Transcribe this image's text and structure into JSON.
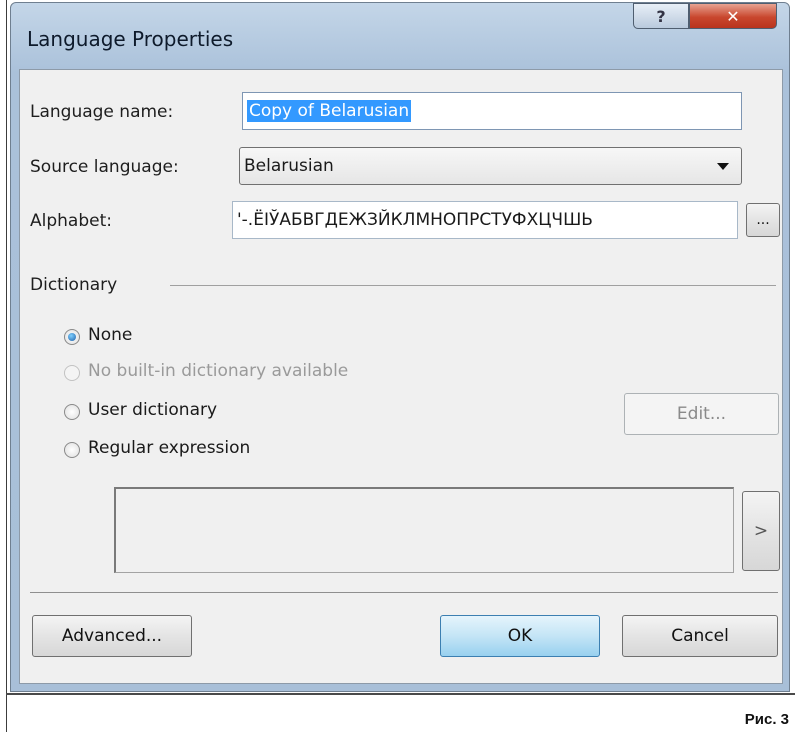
{
  "window": {
    "title": "Language Properties",
    "help_glyph": "?",
    "close_glyph": "✕"
  },
  "fields": {
    "language_name_label": "Language name:",
    "language_name_value": "Copy of Belarusian",
    "source_language_label": "Source language:",
    "source_language_value": "Belarusian",
    "alphabet_label": "Alphabet:",
    "alphabet_value": "'-.ЁІЎАБВГДЕЖЗЙКЛМНОПРСТУФХЦЧШЬ",
    "alphabet_button": "..."
  },
  "dictionary": {
    "heading": "Dictionary",
    "options": [
      {
        "label": "None",
        "selected": true,
        "enabled": true
      },
      {
        "label": "No built-in dictionary available",
        "selected": false,
        "enabled": false
      },
      {
        "label": "User dictionary",
        "selected": false,
        "enabled": true
      },
      {
        "label": "Regular expression",
        "selected": false,
        "enabled": true
      }
    ],
    "edit_button": "Edit...",
    "arrow_button": ">"
  },
  "buttons": {
    "advanced": "Advanced...",
    "ok": "OK",
    "cancel": "Cancel"
  },
  "caption": "Рис. 3"
}
